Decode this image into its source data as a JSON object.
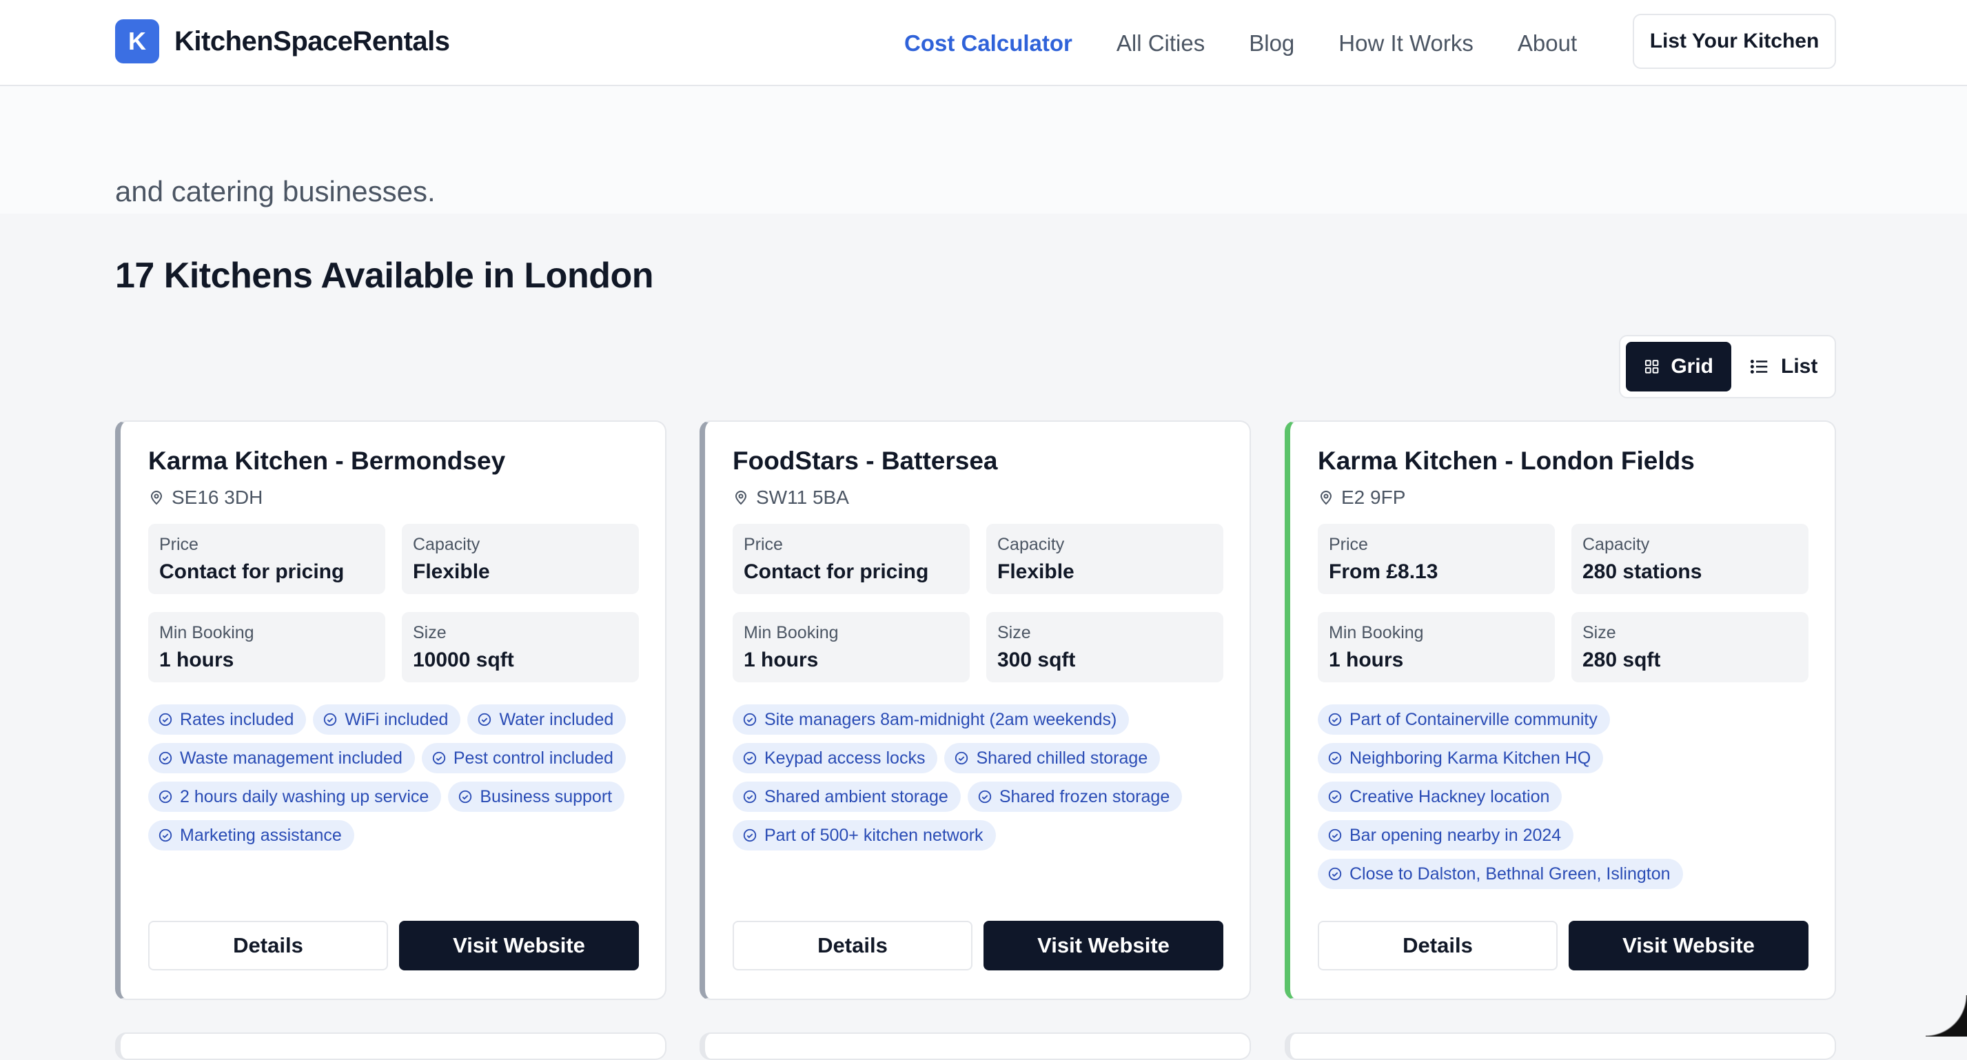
{
  "header": {
    "logo_letter": "K",
    "brand": "KitchenSpaceRentals",
    "nav": [
      "Cost Calculator",
      "All Cities",
      "Blog",
      "How It Works",
      "About"
    ],
    "active_nav": "Cost Calculator",
    "cta": "List Your Kitchen"
  },
  "hero": {
    "text": "and catering businesses."
  },
  "listing": {
    "title": "17 Kitchens Available in London",
    "toggle": {
      "grid": "Grid",
      "list": "List",
      "selected": "Grid"
    }
  },
  "labels": {
    "price": "Price",
    "capacity": "Capacity",
    "min_booking": "Min Booking",
    "size": "Size",
    "details": "Details",
    "visit": "Visit Website"
  },
  "cards": [
    {
      "name": "Karma Kitchen - Bermondsey",
      "postcode": "SE16 3DH",
      "price": "Contact for pricing",
      "capacity": "Flexible",
      "min_booking": "1 hours",
      "size": "10000 sqft",
      "accent": "#9ca3af",
      "tags": [
        "Rates included",
        "WiFi included",
        "Water included",
        "Waste management included",
        "Pest control included",
        "2 hours daily washing up service",
        "Business support",
        "Marketing assistance"
      ]
    },
    {
      "name": "FoodStars - Battersea",
      "postcode": "SW11 5BA",
      "price": "Contact for pricing",
      "capacity": "Flexible",
      "min_booking": "1 hours",
      "size": "300 sqft",
      "accent": "#9ca3af",
      "tags": [
        "Site managers 8am-midnight (2am weekends)",
        "Keypad access locks",
        "Shared chilled storage",
        "Shared ambient storage",
        "Shared frozen storage",
        "Part of 500+ kitchen network"
      ]
    },
    {
      "name": "Karma Kitchen - London Fields",
      "postcode": "E2 9FP",
      "price": "From £8.13",
      "capacity": "280 stations",
      "min_booking": "1 hours",
      "size": "280 sqft",
      "accent": "#5cc36a",
      "tags": [
        "Part of Containerville community",
        "Neighboring Karma Kitchen HQ",
        "Creative Hackney location",
        "Bar opening nearby in 2024",
        "Close to Dalston, Bethnal Green, Islington"
      ]
    }
  ],
  "colors": {
    "brand_blue": "#3b6fe3",
    "nav_active": "#2f62d9",
    "dark": "#0f1729",
    "tag_bg": "#e8effc",
    "tag_text": "#2a4cb5"
  },
  "icons": {
    "pin": "map-pin-icon",
    "check": "check-circle-icon",
    "grid": "grid-icon",
    "list": "list-icon"
  }
}
